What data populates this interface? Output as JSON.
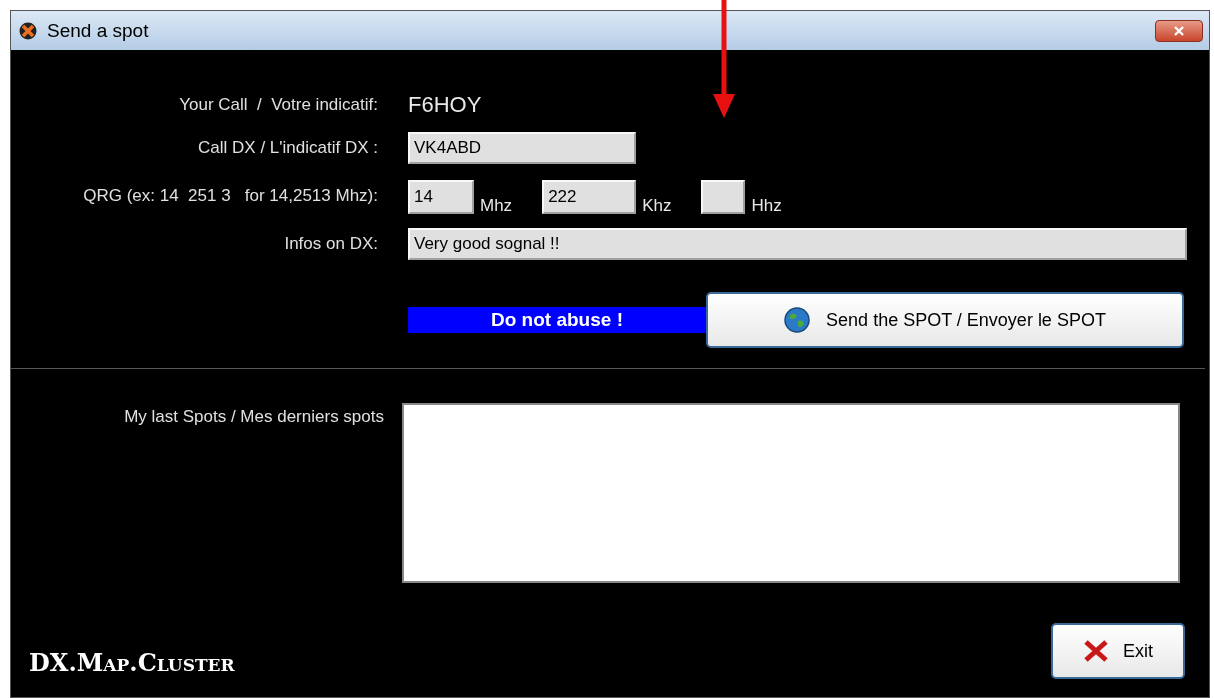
{
  "window": {
    "title": "Send a spot"
  },
  "form": {
    "your_call": {
      "label": "Your Call  /  Votre indicatif:",
      "value": "F6HOY"
    },
    "call_dx": {
      "label": "Call DX / L'indicatif DX :",
      "value": "VK4ABD"
    },
    "qrg": {
      "label": "QRG (ex: 14  251 3   for 14,2513 Mhz):",
      "fields": [
        {
          "value": "14",
          "unit": "Mhz"
        },
        {
          "value": "222",
          "unit": "Khz"
        },
        {
          "unit": "Hhz"
        }
      ]
    },
    "infos": {
      "label": "Infos on DX:",
      "value": "Very good sognal !!"
    }
  },
  "warning": "Do not abuse !",
  "send_button": "Send the SPOT / Envoyer le SPOT",
  "last_spots": {
    "label": "My last Spots / Mes derniers spots"
  },
  "logo": "DX.Map.Cluster",
  "exit_button": "Exit"
}
